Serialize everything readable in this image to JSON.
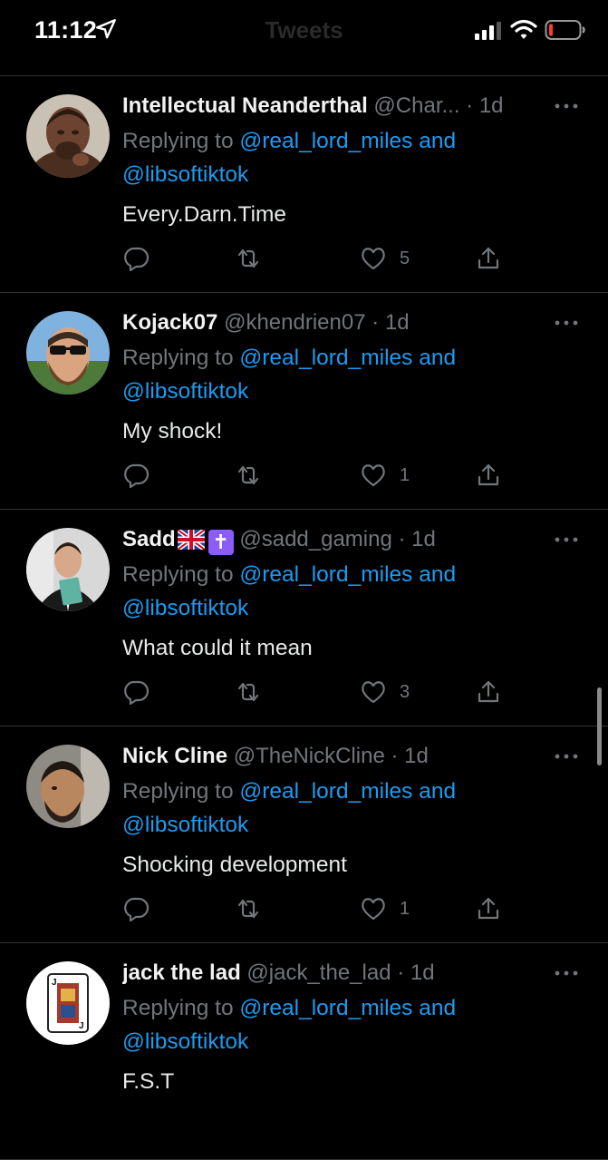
{
  "status_bar": {
    "time": "11:12"
  },
  "header": {
    "title": "Tweets"
  },
  "tweets": [
    {
      "name": "Intellectual Neanderthal",
      "handle": "@Char...",
      "dot": "·",
      "time": "1d",
      "replying_prefix": "Replying to ",
      "mention_1": "@real_lord_miles",
      "and": " and ",
      "mention_2": "@libsoftiktok",
      "text": "Every.Darn.Time",
      "like_count": "5"
    },
    {
      "name": "Kojack07",
      "handle": "@khendrien07",
      "dot": "·",
      "time": "1d",
      "replying_prefix": "Replying to ",
      "mention_1": "@real_lord_miles",
      "and": " and ",
      "mention_2": "@libsoftiktok",
      "text": "My shock!",
      "like_count": "1"
    },
    {
      "name": "Sadd",
      "handle": "@sadd_gaming",
      "dot": "·",
      "time": "1d",
      "replying_prefix": "Replying to ",
      "mention_1": "@real_lord_miles",
      "and": " and ",
      "mention_2": "@libsoftiktok",
      "text": "What could it mean",
      "like_count": "3",
      "badge_glyph": "✝"
    },
    {
      "name": "Nick Cline",
      "handle": "@TheNickCline",
      "dot": "·",
      "time": "1d",
      "replying_prefix": "Replying to ",
      "mention_1": "@real_lord_miles",
      "and": " and ",
      "mention_2": "@libsoftiktok",
      "text": "Shocking development",
      "like_count": "1"
    },
    {
      "name": "jack the lad",
      "handle": "@jack_the_lad",
      "dot": "·",
      "time": "1d",
      "replying_prefix": "Replying to ",
      "mention_1": "@real_lord_miles",
      "and": " and ",
      "mention_2": "@libsoftiktok",
      "text": "F.S.T",
      "like_count": ""
    }
  ],
  "colors": {
    "accent": "#1d9bf0",
    "muted": "#71767b",
    "background": "#000000",
    "divider": "#2f3336"
  },
  "icons": [
    "location-arrow-icon",
    "signal-icon",
    "wifi-icon",
    "battery-icon",
    "more-icon",
    "reply-icon",
    "retweet-icon",
    "like-icon",
    "share-icon"
  ]
}
